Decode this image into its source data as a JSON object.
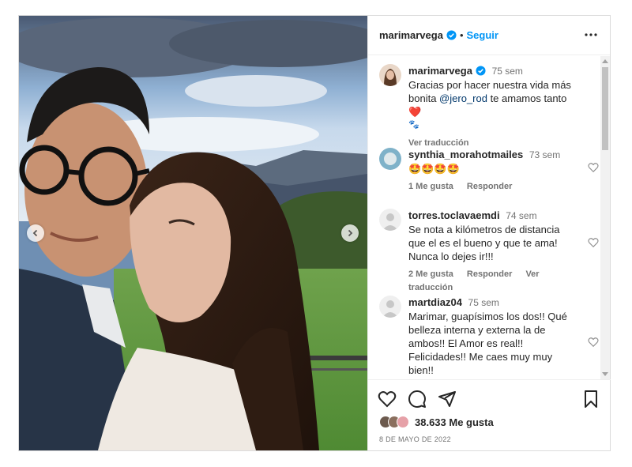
{
  "post": {
    "username": "marimarvega",
    "follow_label": "Seguir",
    "header_separator": "•",
    "more_icon": "more-horizontal-icon"
  },
  "caption": {
    "username": "marimarvega",
    "time": "75 sem",
    "text_before_mention": "Gracias por hacer nuestra vida más bonita ",
    "mention": "@jero_rod",
    "text_after_mention": " te amamos tanto ",
    "emoji": "❤️",
    "emoji2": "🐾",
    "translate_label": "Ver traducción"
  },
  "comments": [
    {
      "username": "synthia_morahotmailes",
      "time": "73 sem",
      "text": "🤩🤩🤩🤩",
      "likes_label": "1 Me gusta",
      "reply_label": "Responder",
      "translate_label": ""
    },
    {
      "username": "torres.toclavaemdi",
      "time": "74 sem",
      "text": "Se nota a kilómetros de distancia que el es el bueno y que te ama! Nunca lo dejes ir!!!",
      "likes_label": "2 Me gusta",
      "reply_label": "Responder",
      "translate_label": "Ver traducción"
    },
    {
      "username": "martdiaz04",
      "time": "75 sem",
      "text": "Marimar, guapísimos los dos!! Qué belleza interna y externa la de ambos!! El Amor es real!! Felicidades!! Me caes muy muy bien!!",
      "likes_label": "",
      "reply_label": "",
      "translate_label": ""
    }
  ],
  "actions": {
    "likes": "38.633 Me gusta",
    "date": "8 de mayo de 2022",
    "icons": [
      "heart-icon",
      "comment-icon",
      "share-icon",
      "bookmark-icon"
    ]
  },
  "colors": {
    "accent": "#0095f6",
    "verified": "#0095f6",
    "secondary_text": "#737373",
    "border": "#dbdbdb"
  }
}
